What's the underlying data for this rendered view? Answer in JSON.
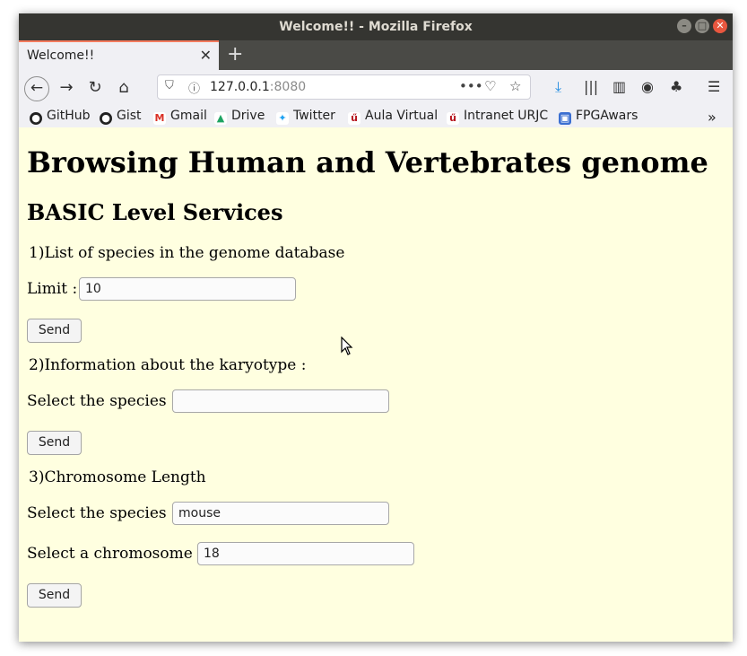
{
  "window": {
    "title": "Welcome!! - Mozilla Firefox"
  },
  "tab": {
    "title": "Welcome!!",
    "close": "✕"
  },
  "newtab": "+",
  "url": {
    "host": "127.0.0.1",
    "port": ":8080"
  },
  "bookmarks": [
    {
      "label": "GitHub",
      "icon": "github-icon",
      "color": "#222222"
    },
    {
      "label": "Gist",
      "icon": "github-icon",
      "color": "#222222"
    },
    {
      "label": "Gmail",
      "icon": "gmail-icon",
      "color": "#d93025"
    },
    {
      "label": "Drive",
      "icon": "drive-icon",
      "color": "#1fa463"
    },
    {
      "label": "Twitter",
      "icon": "twitter-icon",
      "color": "#1da1f2"
    },
    {
      "label": "Aula Virtual",
      "icon": "urjc-icon",
      "color": "#b5121b"
    },
    {
      "label": "Intranet URJC",
      "icon": "urjc-icon",
      "color": "#b5121b"
    },
    {
      "label": "FPGAwars",
      "icon": "fpgawars-icon",
      "color": "#3b6fd1"
    }
  ],
  "page": {
    "title": "Browsing Human and Vertebrates genome",
    "subtitle": "BASIC Level Services",
    "section1": {
      "heading": "1)List of species in the genome database",
      "label": "Limit :",
      "value": "10",
      "button": "Send"
    },
    "section2": {
      "heading": "2)Information about the karyotype :",
      "label": "Select the species :",
      "value": "",
      "button": "Send"
    },
    "section3": {
      "heading": "3)Chromosome Length",
      "label1": "Select the species :",
      "value1": "mouse",
      "label2": "Select a chromosome :",
      "value2": "18",
      "button": "Send"
    }
  }
}
